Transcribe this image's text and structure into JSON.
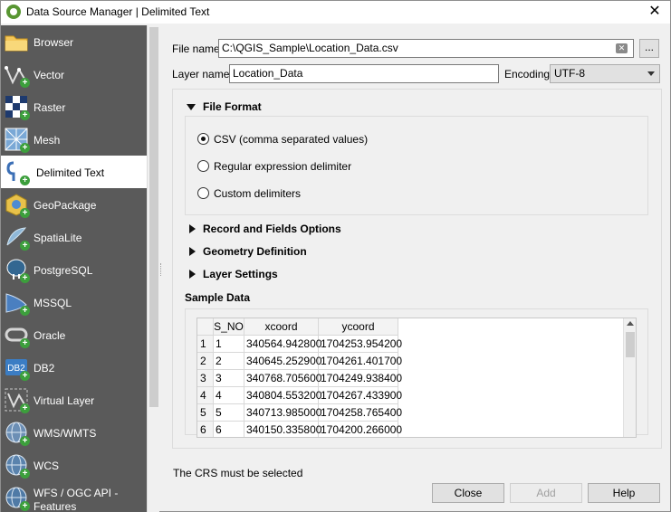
{
  "window": {
    "title": "Data Source Manager | Delimited Text",
    "close_glyph": "✕"
  },
  "sidebar": {
    "items": [
      {
        "label": "Browser",
        "icon": "folder-icon"
      },
      {
        "label": "Vector",
        "icon": "vector-icon"
      },
      {
        "label": "Raster",
        "icon": "raster-icon"
      },
      {
        "label": "Mesh",
        "icon": "mesh-icon"
      },
      {
        "label": "Delimited Text",
        "icon": "delimited-text-icon",
        "active": true
      },
      {
        "label": "GeoPackage",
        "icon": "geopackage-icon"
      },
      {
        "label": "SpatiaLite",
        "icon": "spatialite-icon"
      },
      {
        "label": "PostgreSQL",
        "icon": "postgresql-icon"
      },
      {
        "label": "MSSQL",
        "icon": "mssql-icon"
      },
      {
        "label": "Oracle",
        "icon": "oracle-icon"
      },
      {
        "label": "DB2",
        "icon": "db2-icon"
      },
      {
        "label": "Virtual Layer",
        "icon": "virtual-layer-icon"
      },
      {
        "label": "WMS/WMTS",
        "icon": "wms-icon"
      },
      {
        "label": "WCS",
        "icon": "wcs-icon"
      },
      {
        "label_line1": "WFS / OGC API -",
        "label_line2": "Features",
        "icon": "wfs-icon"
      }
    ],
    "db2_icon_text": "DB2"
  },
  "form": {
    "file_name_label": "File name",
    "file_name_value": "C:\\QGIS_Sample\\Location_Data.csv",
    "browse_label": "...",
    "layer_name_label": "Layer name",
    "layer_name_value": "Location_Data",
    "encoding_label": "Encoding",
    "encoding_value": "UTF-8"
  },
  "file_format": {
    "title": "File Format",
    "options": [
      {
        "label": "CSV (comma separated values)",
        "checked": true
      },
      {
        "label": "Regular expression delimiter",
        "checked": false
      },
      {
        "label": "Custom delimiters",
        "checked": false
      }
    ]
  },
  "collapsed_sections": [
    "Record and Fields Options",
    "Geometry Definition",
    "Layer Settings"
  ],
  "sample_data": {
    "title": "Sample Data",
    "columns": [
      "S_NO",
      "xcoord",
      "ycoord"
    ],
    "rows": [
      {
        "index": "1",
        "cells": [
          "1",
          "340564.942800",
          "1704253.954200"
        ]
      },
      {
        "index": "2",
        "cells": [
          "2",
          "340645.252900",
          "1704261.401700"
        ]
      },
      {
        "index": "3",
        "cells": [
          "3",
          "340768.705600",
          "1704249.938400"
        ]
      },
      {
        "index": "4",
        "cells": [
          "4",
          "340804.553200",
          "1704267.433900"
        ]
      },
      {
        "index": "5",
        "cells": [
          "5",
          "340713.985000",
          "1704258.765400"
        ]
      },
      {
        "index": "6",
        "cells": [
          "6",
          "340150.335800",
          "1704200.266000"
        ]
      }
    ]
  },
  "status_text": "The CRS must be selected",
  "buttons": {
    "close": "Close",
    "add": "Add",
    "help": "Help"
  },
  "colors": {
    "sidebar_bg": "#5a5a5a",
    "qgis_green": "#589632",
    "add_badge": "#3c9f3c"
  }
}
